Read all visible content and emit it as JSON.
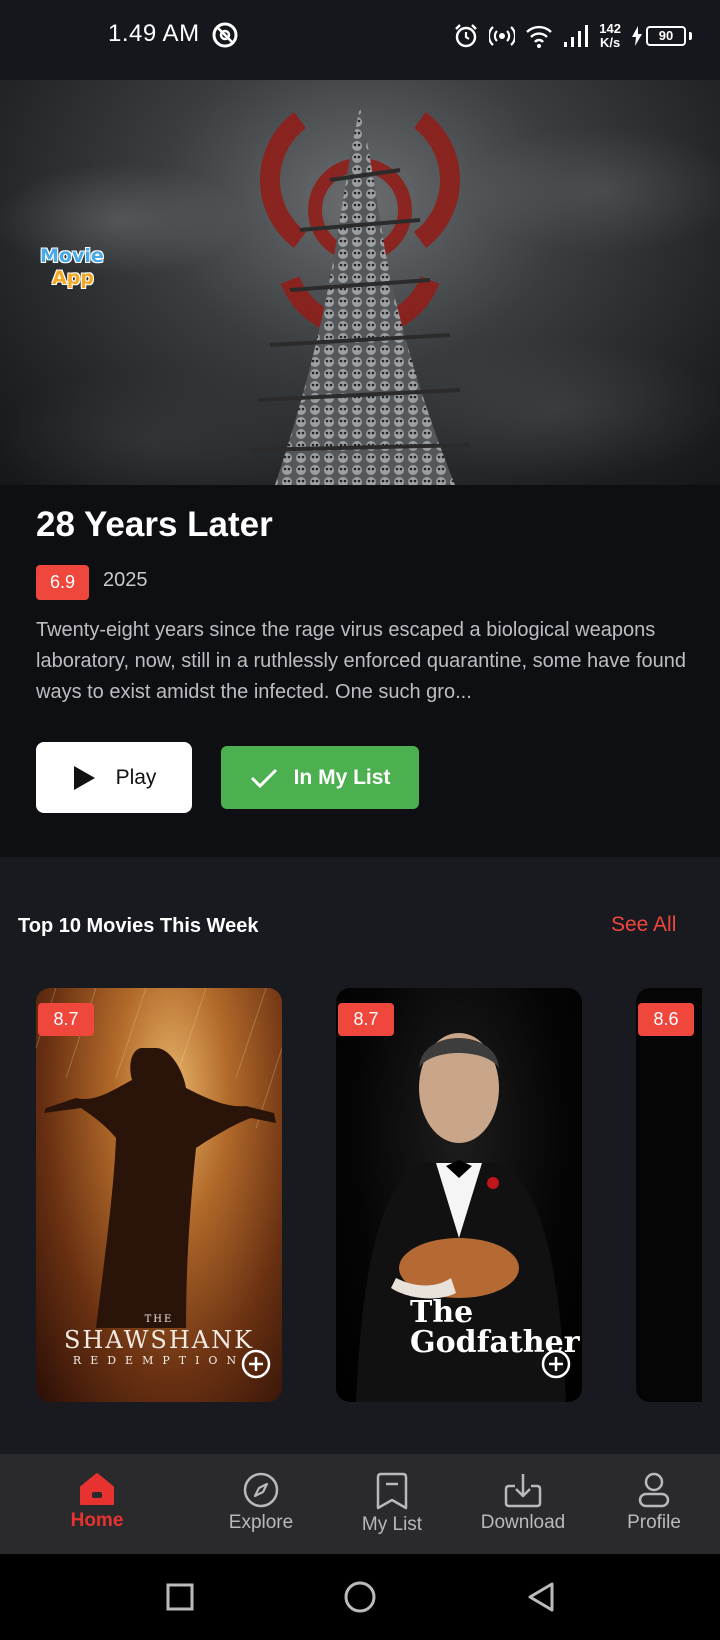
{
  "status_bar": {
    "time": "1.49 AM",
    "net_speed_value": "142",
    "net_speed_unit": "K/s",
    "battery": "90"
  },
  "hero": {
    "logo_line1": "Movie",
    "logo_line2": "App"
  },
  "featured": {
    "title": "28 Years Later",
    "rating": "6.9",
    "year": "2025",
    "description": "Twenty-eight years since the rage virus escaped a biological weapons laboratory, now, still in a ruthlessly enforced quarantine, some have found ways to exist amidst the infected. One such gro...",
    "play_label": "Play",
    "list_label": "In My List"
  },
  "top10": {
    "title": "Top 10 Movies This Week",
    "see_all": "See All",
    "movies": [
      {
        "rating": "8.7",
        "poster_small": "THE",
        "poster_title": "SHAWSHANK",
        "poster_subtitle": "REDEMPTION"
      },
      {
        "rating": "8.7",
        "poster_title_1": "The",
        "poster_title_2": "Godfather"
      },
      {
        "rating": "8.6"
      }
    ]
  },
  "bottom_nav": {
    "items": [
      {
        "label": "Home",
        "icon": "home-icon",
        "active": true
      },
      {
        "label": "Explore",
        "icon": "compass-icon"
      },
      {
        "label": "My List",
        "icon": "bookmark-icon"
      },
      {
        "label": "Download",
        "icon": "download-icon"
      },
      {
        "label": "Profile",
        "icon": "profile-icon"
      }
    ]
  },
  "colors": {
    "accent": "#f0473d",
    "list_button": "#4caf50",
    "background": "#181a20"
  }
}
